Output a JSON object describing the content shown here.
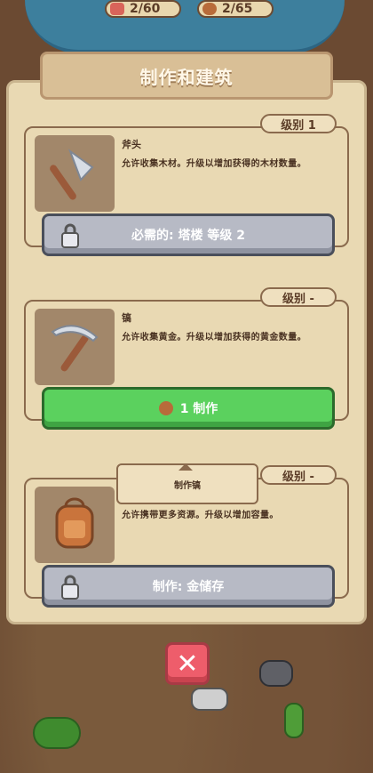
{
  "resources": [
    {
      "icon": "meat-icon",
      "value": "2/60"
    },
    {
      "icon": "wood-icon",
      "value": "2/65"
    }
  ],
  "title": "制作和建筑",
  "items": [
    {
      "name": "斧头",
      "desc": "允许收集木材。升级以增加获得的木材数量。",
      "level": "级别 1",
      "button": "必需的: 塔楼 等级 2",
      "button_type": "locked"
    },
    {
      "name": "镐",
      "desc": "允许收集黄金。升级以增加获得的黄金数量。",
      "level": "级别 -",
      "button": "1 制作",
      "button_type": "craft",
      "cost_icon": "wood-icon"
    },
    {
      "name": "",
      "desc": "允许携带更多资源。升级以增加容量。",
      "level": "级别 -",
      "button": "制作: 金储存",
      "button_type": "locked"
    }
  ],
  "tooltip": "制作镐",
  "close_icon": "close-icon",
  "colors": {
    "craft_green": "#5bd15e",
    "locked_gray": "#b7bac5",
    "close_red": "#ee5d6b"
  }
}
